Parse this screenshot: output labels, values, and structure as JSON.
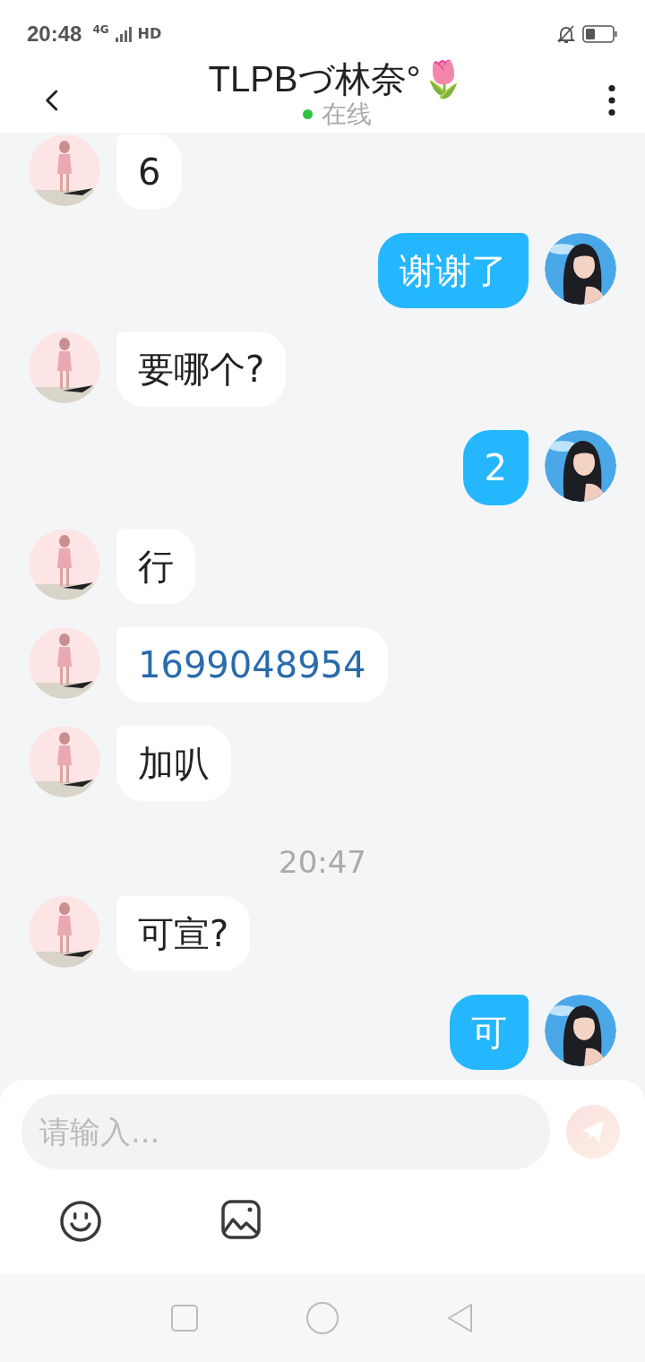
{
  "status_bar": {
    "time": "20:48",
    "network": "4G",
    "hd": "HD"
  },
  "header": {
    "title": "TLPBづ林奈°🌷",
    "status": "在线",
    "online": true
  },
  "messages": [
    {
      "kind": "message",
      "outgoing": false,
      "text": "6"
    },
    {
      "kind": "message",
      "outgoing": true,
      "text": "谢谢了"
    },
    {
      "kind": "message",
      "outgoing": false,
      "text": "要哪个?"
    },
    {
      "kind": "message",
      "outgoing": true,
      "text": "2"
    },
    {
      "kind": "message",
      "outgoing": false,
      "text": "行"
    },
    {
      "kind": "link",
      "outgoing": false,
      "text": "1699048954"
    },
    {
      "kind": "message",
      "outgoing": false,
      "text": "加叭"
    },
    {
      "kind": "time",
      "text": "20:47"
    },
    {
      "kind": "message",
      "outgoing": false,
      "text": "可宣?"
    },
    {
      "kind": "message",
      "outgoing": true,
      "text": "可"
    }
  ],
  "input": {
    "placeholder": "请输入..."
  },
  "send_button": {
    "disabled": true
  }
}
